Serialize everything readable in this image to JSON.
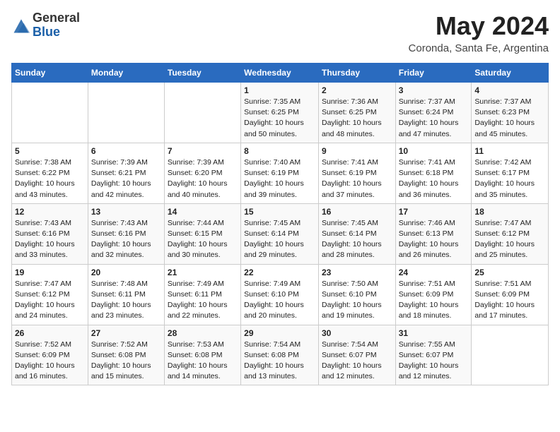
{
  "header": {
    "logo_general": "General",
    "logo_blue": "Blue",
    "month_year": "May 2024",
    "location": "Coronda, Santa Fe, Argentina"
  },
  "days_of_week": [
    "Sunday",
    "Monday",
    "Tuesday",
    "Wednesday",
    "Thursday",
    "Friday",
    "Saturday"
  ],
  "weeks": [
    [
      {
        "num": "",
        "info": ""
      },
      {
        "num": "",
        "info": ""
      },
      {
        "num": "",
        "info": ""
      },
      {
        "num": "1",
        "info": "Sunrise: 7:35 AM\nSunset: 6:25 PM\nDaylight: 10 hours\nand 50 minutes."
      },
      {
        "num": "2",
        "info": "Sunrise: 7:36 AM\nSunset: 6:25 PM\nDaylight: 10 hours\nand 48 minutes."
      },
      {
        "num": "3",
        "info": "Sunrise: 7:37 AM\nSunset: 6:24 PM\nDaylight: 10 hours\nand 47 minutes."
      },
      {
        "num": "4",
        "info": "Sunrise: 7:37 AM\nSunset: 6:23 PM\nDaylight: 10 hours\nand 45 minutes."
      }
    ],
    [
      {
        "num": "5",
        "info": "Sunrise: 7:38 AM\nSunset: 6:22 PM\nDaylight: 10 hours\nand 43 minutes."
      },
      {
        "num": "6",
        "info": "Sunrise: 7:39 AM\nSunset: 6:21 PM\nDaylight: 10 hours\nand 42 minutes."
      },
      {
        "num": "7",
        "info": "Sunrise: 7:39 AM\nSunset: 6:20 PM\nDaylight: 10 hours\nand 40 minutes."
      },
      {
        "num": "8",
        "info": "Sunrise: 7:40 AM\nSunset: 6:19 PM\nDaylight: 10 hours\nand 39 minutes."
      },
      {
        "num": "9",
        "info": "Sunrise: 7:41 AM\nSunset: 6:19 PM\nDaylight: 10 hours\nand 37 minutes."
      },
      {
        "num": "10",
        "info": "Sunrise: 7:41 AM\nSunset: 6:18 PM\nDaylight: 10 hours\nand 36 minutes."
      },
      {
        "num": "11",
        "info": "Sunrise: 7:42 AM\nSunset: 6:17 PM\nDaylight: 10 hours\nand 35 minutes."
      }
    ],
    [
      {
        "num": "12",
        "info": "Sunrise: 7:43 AM\nSunset: 6:16 PM\nDaylight: 10 hours\nand 33 minutes."
      },
      {
        "num": "13",
        "info": "Sunrise: 7:43 AM\nSunset: 6:16 PM\nDaylight: 10 hours\nand 32 minutes."
      },
      {
        "num": "14",
        "info": "Sunrise: 7:44 AM\nSunset: 6:15 PM\nDaylight: 10 hours\nand 30 minutes."
      },
      {
        "num": "15",
        "info": "Sunrise: 7:45 AM\nSunset: 6:14 PM\nDaylight: 10 hours\nand 29 minutes."
      },
      {
        "num": "16",
        "info": "Sunrise: 7:45 AM\nSunset: 6:14 PM\nDaylight: 10 hours\nand 28 minutes."
      },
      {
        "num": "17",
        "info": "Sunrise: 7:46 AM\nSunset: 6:13 PM\nDaylight: 10 hours\nand 26 minutes."
      },
      {
        "num": "18",
        "info": "Sunrise: 7:47 AM\nSunset: 6:12 PM\nDaylight: 10 hours\nand 25 minutes."
      }
    ],
    [
      {
        "num": "19",
        "info": "Sunrise: 7:47 AM\nSunset: 6:12 PM\nDaylight: 10 hours\nand 24 minutes."
      },
      {
        "num": "20",
        "info": "Sunrise: 7:48 AM\nSunset: 6:11 PM\nDaylight: 10 hours\nand 23 minutes."
      },
      {
        "num": "21",
        "info": "Sunrise: 7:49 AM\nSunset: 6:11 PM\nDaylight: 10 hours\nand 22 minutes."
      },
      {
        "num": "22",
        "info": "Sunrise: 7:49 AM\nSunset: 6:10 PM\nDaylight: 10 hours\nand 20 minutes."
      },
      {
        "num": "23",
        "info": "Sunrise: 7:50 AM\nSunset: 6:10 PM\nDaylight: 10 hours\nand 19 minutes."
      },
      {
        "num": "24",
        "info": "Sunrise: 7:51 AM\nSunset: 6:09 PM\nDaylight: 10 hours\nand 18 minutes."
      },
      {
        "num": "25",
        "info": "Sunrise: 7:51 AM\nSunset: 6:09 PM\nDaylight: 10 hours\nand 17 minutes."
      }
    ],
    [
      {
        "num": "26",
        "info": "Sunrise: 7:52 AM\nSunset: 6:09 PM\nDaylight: 10 hours\nand 16 minutes."
      },
      {
        "num": "27",
        "info": "Sunrise: 7:52 AM\nSunset: 6:08 PM\nDaylight: 10 hours\nand 15 minutes."
      },
      {
        "num": "28",
        "info": "Sunrise: 7:53 AM\nSunset: 6:08 PM\nDaylight: 10 hours\nand 14 minutes."
      },
      {
        "num": "29",
        "info": "Sunrise: 7:54 AM\nSunset: 6:08 PM\nDaylight: 10 hours\nand 13 minutes."
      },
      {
        "num": "30",
        "info": "Sunrise: 7:54 AM\nSunset: 6:07 PM\nDaylight: 10 hours\nand 12 minutes."
      },
      {
        "num": "31",
        "info": "Sunrise: 7:55 AM\nSunset: 6:07 PM\nDaylight: 10 hours\nand 12 minutes."
      },
      {
        "num": "",
        "info": ""
      }
    ]
  ]
}
